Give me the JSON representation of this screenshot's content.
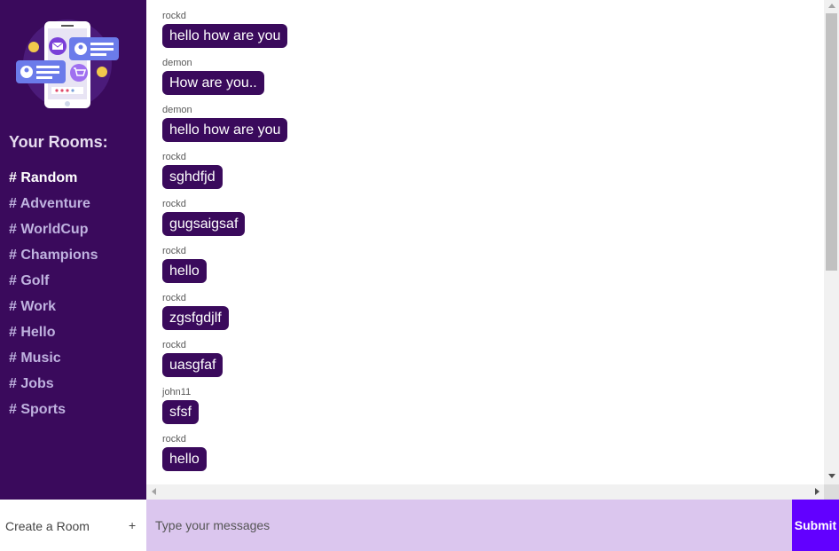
{
  "sidebar": {
    "rooms_title": "Your Rooms:",
    "rooms": [
      {
        "label": "# Random",
        "active": true
      },
      {
        "label": "# Adventure",
        "active": false
      },
      {
        "label": "# WorldCup",
        "active": false
      },
      {
        "label": "# Champions",
        "active": false
      },
      {
        "label": "# Golf",
        "active": false
      },
      {
        "label": "# Work",
        "active": false
      },
      {
        "label": "# Hello",
        "active": false
      },
      {
        "label": "# Music",
        "active": false
      },
      {
        "label": "# Jobs",
        "active": false
      },
      {
        "label": "# Sports",
        "active": false
      }
    ],
    "logo_icon": "phone-chat-illustration"
  },
  "messages": [
    {
      "user": "rockd",
      "text": "hello how are you"
    },
    {
      "user": "demon",
      "text": "How are you.."
    },
    {
      "user": "demon",
      "text": "hello how are you"
    },
    {
      "user": "rockd",
      "text": "sghdfjd"
    },
    {
      "user": "rockd",
      "text": "gugsaigsaf"
    },
    {
      "user": "rockd",
      "text": "hello"
    },
    {
      "user": "rockd",
      "text": "zgsfgdjlf"
    },
    {
      "user": "rockd",
      "text": "uasgfaf"
    },
    {
      "user": "john11",
      "text": "sfsf"
    },
    {
      "user": "rockd",
      "text": "hello"
    }
  ],
  "footer": {
    "create_room_label": "Create a Room",
    "create_room_icon": "+",
    "message_placeholder": "Type your messages",
    "submit_label": "Submit"
  },
  "colors": {
    "sidebar_bg": "#3a0a5c",
    "bubble_bg": "#3a0a5c",
    "input_bg": "#dbc6ee",
    "submit_bg": "#6200ff"
  }
}
